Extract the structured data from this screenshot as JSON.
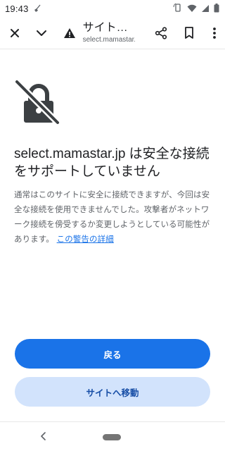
{
  "status_bar": {
    "time": "19:43"
  },
  "toolbar": {
    "title": "サイト…",
    "url": "select.mamastar.jp"
  },
  "content": {
    "heading": "select.mamastar.jp は安全な接続をサポートしていません",
    "body": "通常はこのサイトに安全に接続できますが、今回は安全な接続を使用できませんでした。攻撃者がネットワーク接続を傍受するか変更しようとしている可能性があります。",
    "details_link": "この警告の詳細"
  },
  "buttons": {
    "back": "戻る",
    "proceed": "サイトへ移動"
  },
  "colors": {
    "accent": "#1a73e8",
    "secondary_button_bg": "#d2e3fc",
    "secondary_button_text": "#174ea6",
    "body_text": "#5f6368"
  }
}
